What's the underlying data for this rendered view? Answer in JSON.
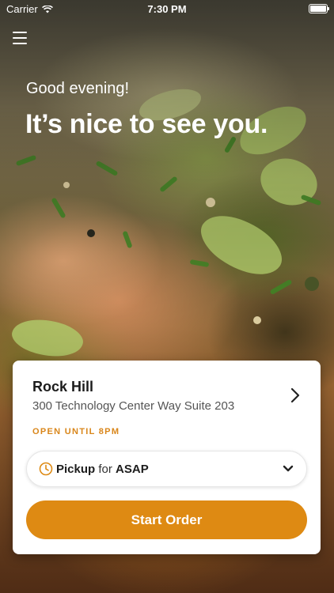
{
  "status_bar": {
    "carrier": "Carrier",
    "time": "7:30 PM"
  },
  "header": {
    "menu_icon": "hamburger-menu-icon",
    "greeting": "Good evening!",
    "headline": "It’s nice to see you."
  },
  "store": {
    "name": "Rock Hill",
    "address": "300 Technology Center Way Suite 203",
    "hours": "OPEN UNTIL 8PM"
  },
  "order_mode": {
    "mode": "Pickup",
    "connector": "for",
    "time": "ASAP"
  },
  "actions": {
    "start_order": "Start Order"
  },
  "colors": {
    "accent": "#de8a13",
    "hours_text": "#d9861a"
  }
}
